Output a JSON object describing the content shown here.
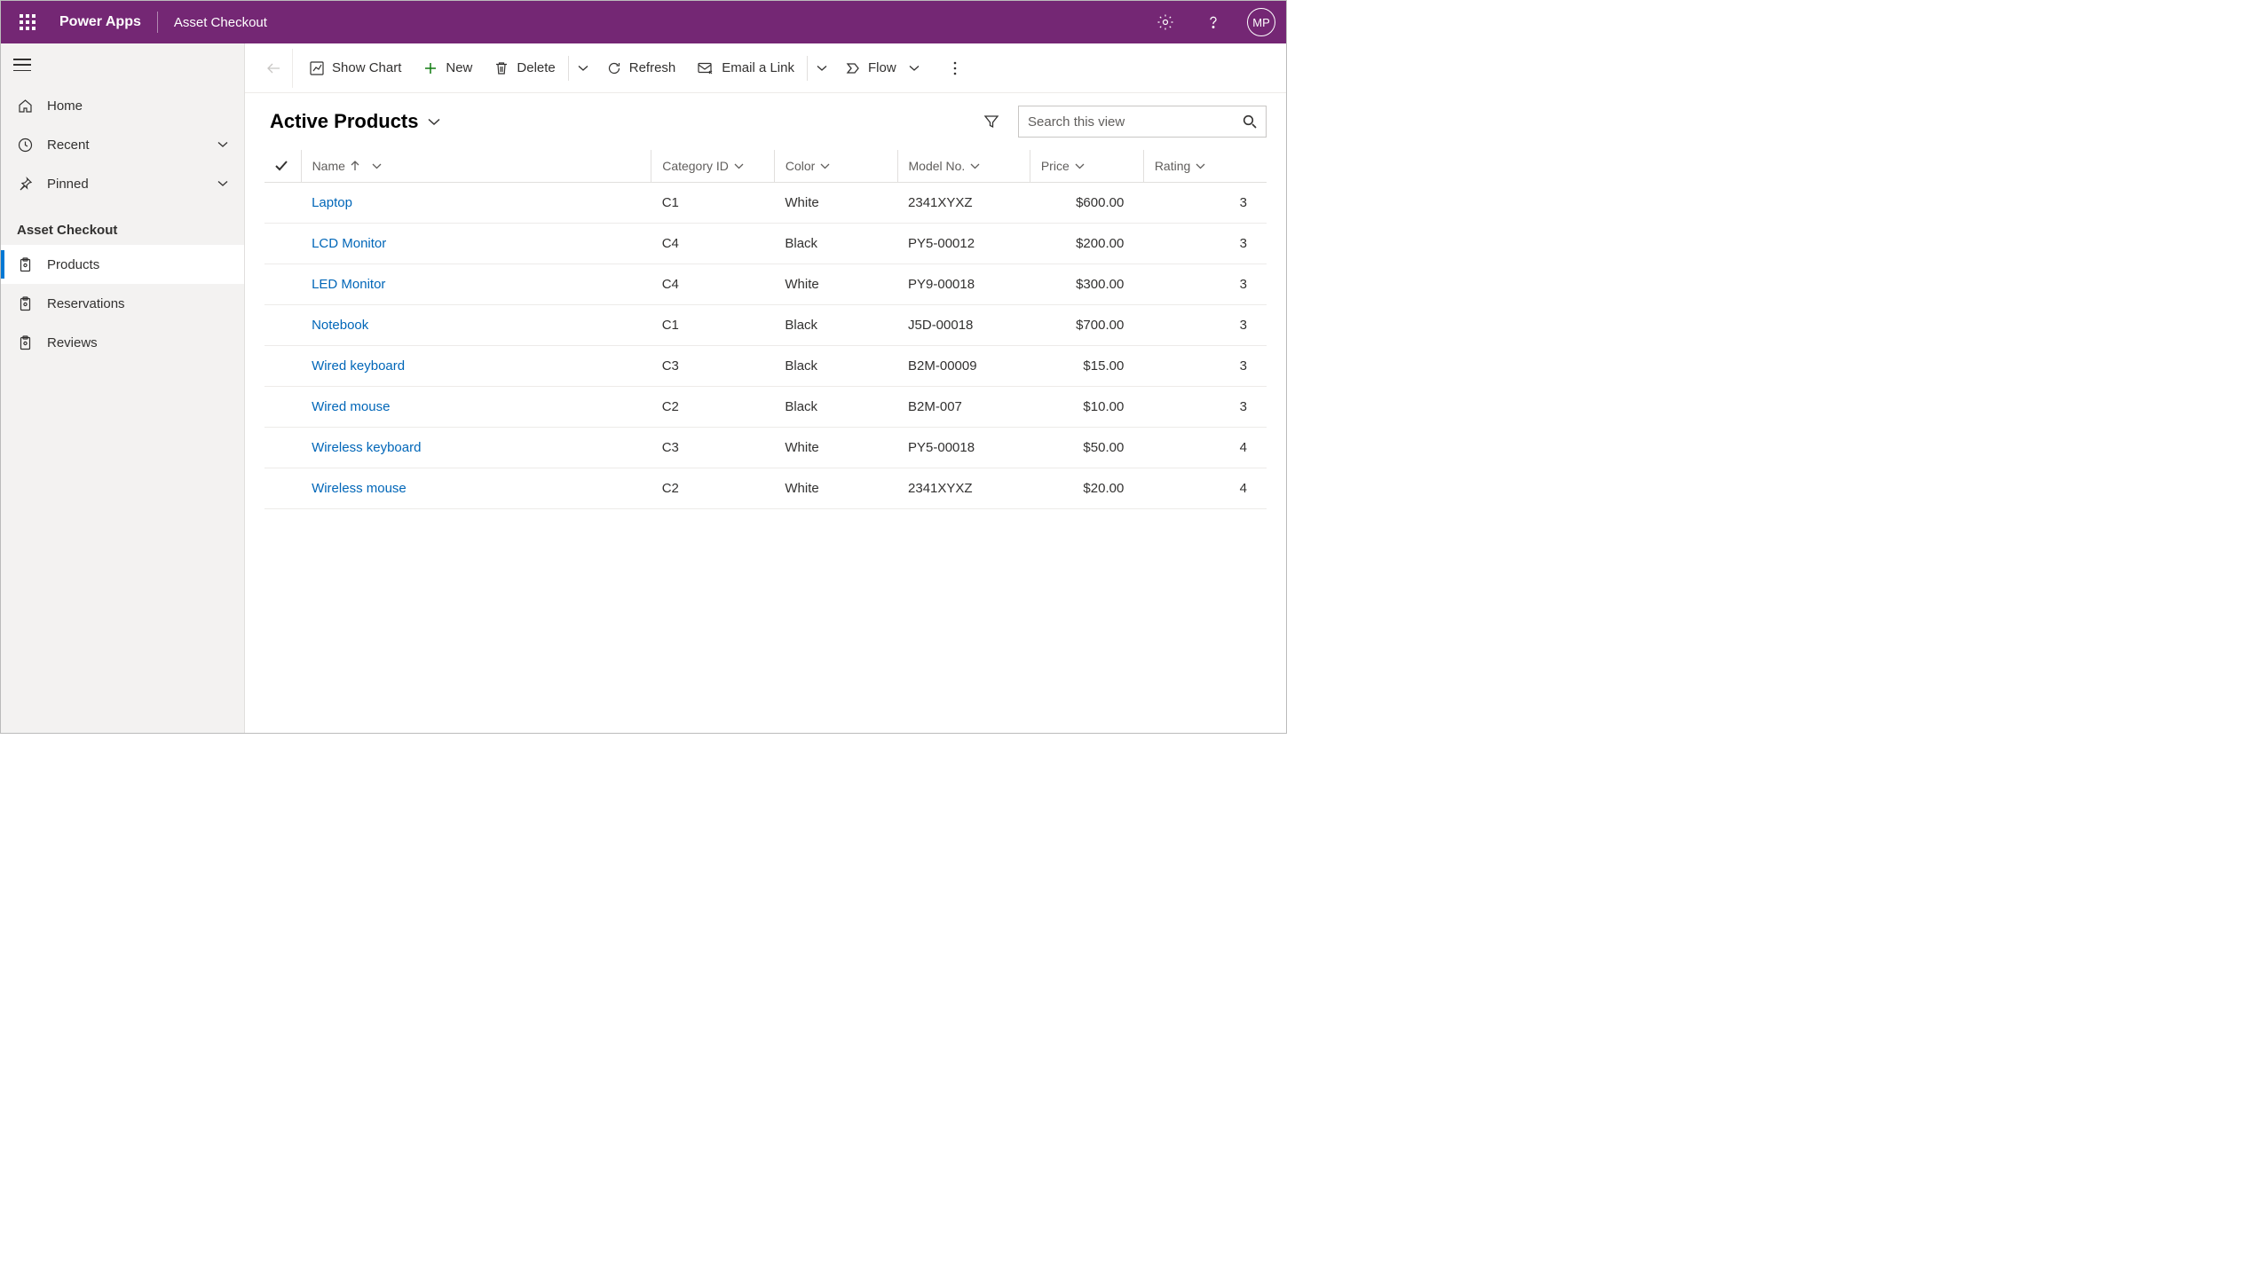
{
  "header": {
    "app_title": "Power Apps",
    "environment": "Asset Checkout",
    "avatar_initials": "MP"
  },
  "sidebar": {
    "nav": {
      "home": "Home",
      "recent": "Recent",
      "pinned": "Pinned"
    },
    "section_title": "Asset Checkout",
    "items": [
      {
        "label": "Products",
        "active": true
      },
      {
        "label": "Reservations",
        "active": false
      },
      {
        "label": "Reviews",
        "active": false
      }
    ]
  },
  "cmdbar": {
    "show_chart": "Show Chart",
    "new": "New",
    "delete": "Delete",
    "refresh": "Refresh",
    "email_link": "Email a Link",
    "flow": "Flow"
  },
  "view": {
    "title": "Active Products",
    "search_placeholder": "Search this view"
  },
  "columns": {
    "name": "Name",
    "category": "Category ID",
    "color": "Color",
    "model": "Model No.",
    "price": "Price",
    "rating": "Rating"
  },
  "rows": [
    {
      "name": "Laptop",
      "category": "C1",
      "color": "White",
      "model": "2341XYXZ",
      "price": "$600.00",
      "rating": "3"
    },
    {
      "name": "LCD Monitor",
      "category": "C4",
      "color": "Black",
      "model": "PY5-00012",
      "price": "$200.00",
      "rating": "3"
    },
    {
      "name": "LED Monitor",
      "category": "C4",
      "color": "White",
      "model": "PY9-00018",
      "price": "$300.00",
      "rating": "3"
    },
    {
      "name": "Notebook",
      "category": "C1",
      "color": "Black",
      "model": "J5D-00018",
      "price": "$700.00",
      "rating": "3"
    },
    {
      "name": "Wired keyboard",
      "category": "C3",
      "color": "Black",
      "model": "B2M-00009",
      "price": "$15.00",
      "rating": "3"
    },
    {
      "name": "Wired mouse",
      "category": "C2",
      "color": "Black",
      "model": "B2M-007",
      "price": "$10.00",
      "rating": "3"
    },
    {
      "name": "Wireless keyboard",
      "category": "C3",
      "color": "White",
      "model": "PY5-00018",
      "price": "$50.00",
      "rating": "4"
    },
    {
      "name": "Wireless mouse",
      "category": "C2",
      "color": "White",
      "model": "2341XYXZ",
      "price": "$20.00",
      "rating": "4"
    }
  ]
}
